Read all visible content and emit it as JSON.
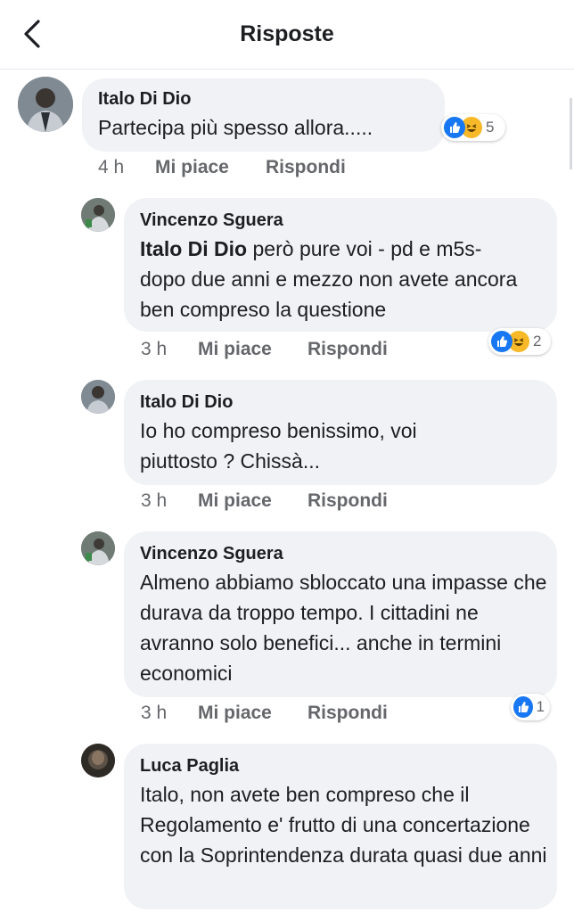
{
  "header": {
    "title": "Risposte",
    "back_icon": "chevron-left-icon"
  },
  "comments": [
    {
      "author": "Italo Di Dio",
      "text": "Partecipa più spesso allora.....",
      "time": "4 h",
      "like": "Mi piace",
      "reply": "Rispondi",
      "reactions": {
        "types": [
          "like",
          "haha"
        ],
        "count": "5"
      }
    },
    {
      "author": "Vincenzo Sguera",
      "mention": "Italo Di Dio",
      "text_line1": " però pure voi - pd e m5s-",
      "text_rest": "dopo due anni e mezzo non avete ancora ben compreso la questione",
      "time": "3 h",
      "like": "Mi piace",
      "reply": "Rispondi",
      "reactions": {
        "types": [
          "like",
          "haha"
        ],
        "count": "2"
      }
    },
    {
      "author": "Italo Di Dio",
      "text": "Io ho compreso benissimo, voi piuttosto ? Chissà...",
      "time": "3 h",
      "like": "Mi piace",
      "reply": "Rispondi"
    },
    {
      "author": "Vincenzo Sguera",
      "text": "Almeno abbiamo sbloccato una impasse che durava da troppo tempo. I cittadini ne avranno solo benefici... anche in termini economici",
      "time": "3 h",
      "like": "Mi piace",
      "reply": "Rispondi",
      "reactions": {
        "types": [
          "like"
        ],
        "count": "1"
      }
    },
    {
      "author": "Luca Paglia",
      "text": "Italo, non avete ben compreso che il Regolamento e' frutto di una concertazione con la Soprintendenza durata quasi due anni"
    }
  ],
  "colors": {
    "accent": "#1877f2",
    "bubble": "#f0f2f5",
    "secondary_text": "#65676b",
    "haha": "#f7b928"
  }
}
